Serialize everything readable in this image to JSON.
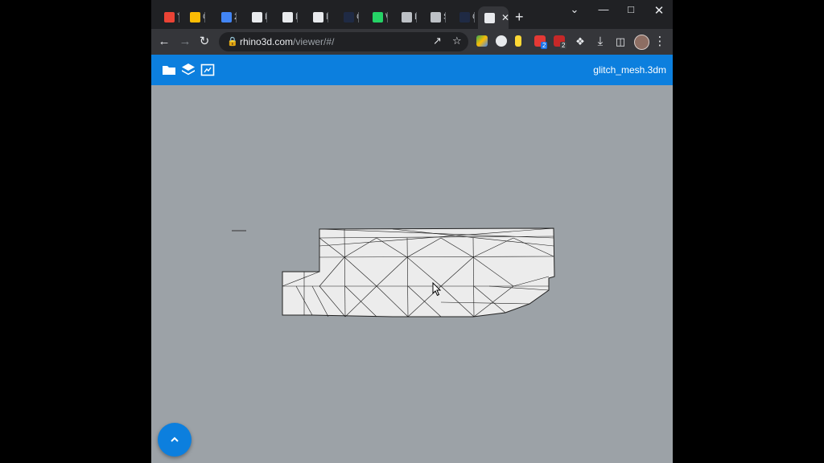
{
  "browser": {
    "tabs": [
      {
        "title": "Yo",
        "favicon": "gmail-icon",
        "color": "#ea4335"
      },
      {
        "title": "O",
        "favicon": "calendar-icon",
        "color": "#fbbc04"
      },
      {
        "title": "2(",
        "favicon": "docs-icon",
        "color": "#4285f4"
      },
      {
        "title": "Pr",
        "favicon": "clockify-icon",
        "color": "#e8eaed"
      },
      {
        "title": "N",
        "favicon": "clockify-icon",
        "color": "#e8eaed"
      },
      {
        "title": "M",
        "favicon": "clockify-icon",
        "color": "#e8eaed"
      },
      {
        "title": "C",
        "favicon": "circle-icon",
        "color": "#1f2a44"
      },
      {
        "title": "W",
        "favicon": "whatsapp-icon",
        "color": "#25d366"
      },
      {
        "title": "Li",
        "favicon": "rhino-icon",
        "color": "#bdc1c6"
      },
      {
        "title": "S",
        "favicon": "rhino-icon",
        "color": "#bdc1c6"
      },
      {
        "title": "C",
        "favicon": "circle-icon",
        "color": "#1f2a44"
      },
      {
        "title": "",
        "favicon": "rhino-icon",
        "color": "#e8eaed",
        "active": true
      }
    ],
    "new_tab_label": "+",
    "url_domain": "rhino3d.com",
    "url_path": "/viewer/#/"
  },
  "app": {
    "file_name": "glitch_mesh.3dm",
    "accent": "#0c7fde",
    "viewport_bg": "#9ca2a7"
  }
}
